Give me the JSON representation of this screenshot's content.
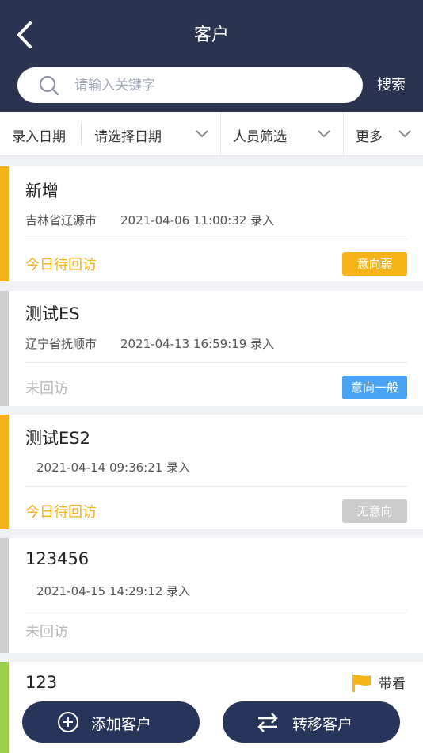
{
  "header": {
    "title": "客户",
    "search_placeholder": "请输入关键字",
    "search_label": "搜索"
  },
  "filters": {
    "entry_date_label": "录入日期",
    "date_select": "请选择日期",
    "staff_filter": "人员筛选",
    "more": "更多"
  },
  "customers": [
    {
      "name": "新增",
      "region": "吉林省辽源市",
      "entry_time": "2021-04-06 11:00:32 录入",
      "followup": "今日待回访",
      "intent": "意向弱"
    },
    {
      "name": "测试ES",
      "region": "辽宁省抚顺市",
      "entry_time": "2021-04-13 16:59:19 录入",
      "followup": "未回访",
      "intent": "意向一般"
    },
    {
      "name": "测试ES2",
      "region": "",
      "entry_time": "2021-04-14 09:36:21 录入",
      "followup": "今日待回访",
      "intent": "无意向"
    },
    {
      "name": "123456",
      "region": "",
      "entry_time": "2021-04-15 14:29:12 录入",
      "followup": "未回访"
    },
    {
      "name": "123",
      "badge": "带看"
    }
  ],
  "colors": {
    "header_bg": "#2a3450",
    "pending_followup": "#f5b11a",
    "no_followup": "#b8b8b8",
    "intent_weak": "#f6b418",
    "intent_normal": "#4aa3f2",
    "intent_none": "#cccccc",
    "stripe_green": "#9ad14b",
    "button_bg": "#27355a"
  },
  "icons": {
    "back": "chevron-left-icon",
    "search": "search-icon",
    "chevron": "chevron-down-icon",
    "flag": "flag-icon",
    "add": "plus-circle-icon",
    "transfer": "transfer-arrows-icon"
  },
  "actions": {
    "add_customer": "添加客户",
    "transfer_customer": "转移客户"
  }
}
